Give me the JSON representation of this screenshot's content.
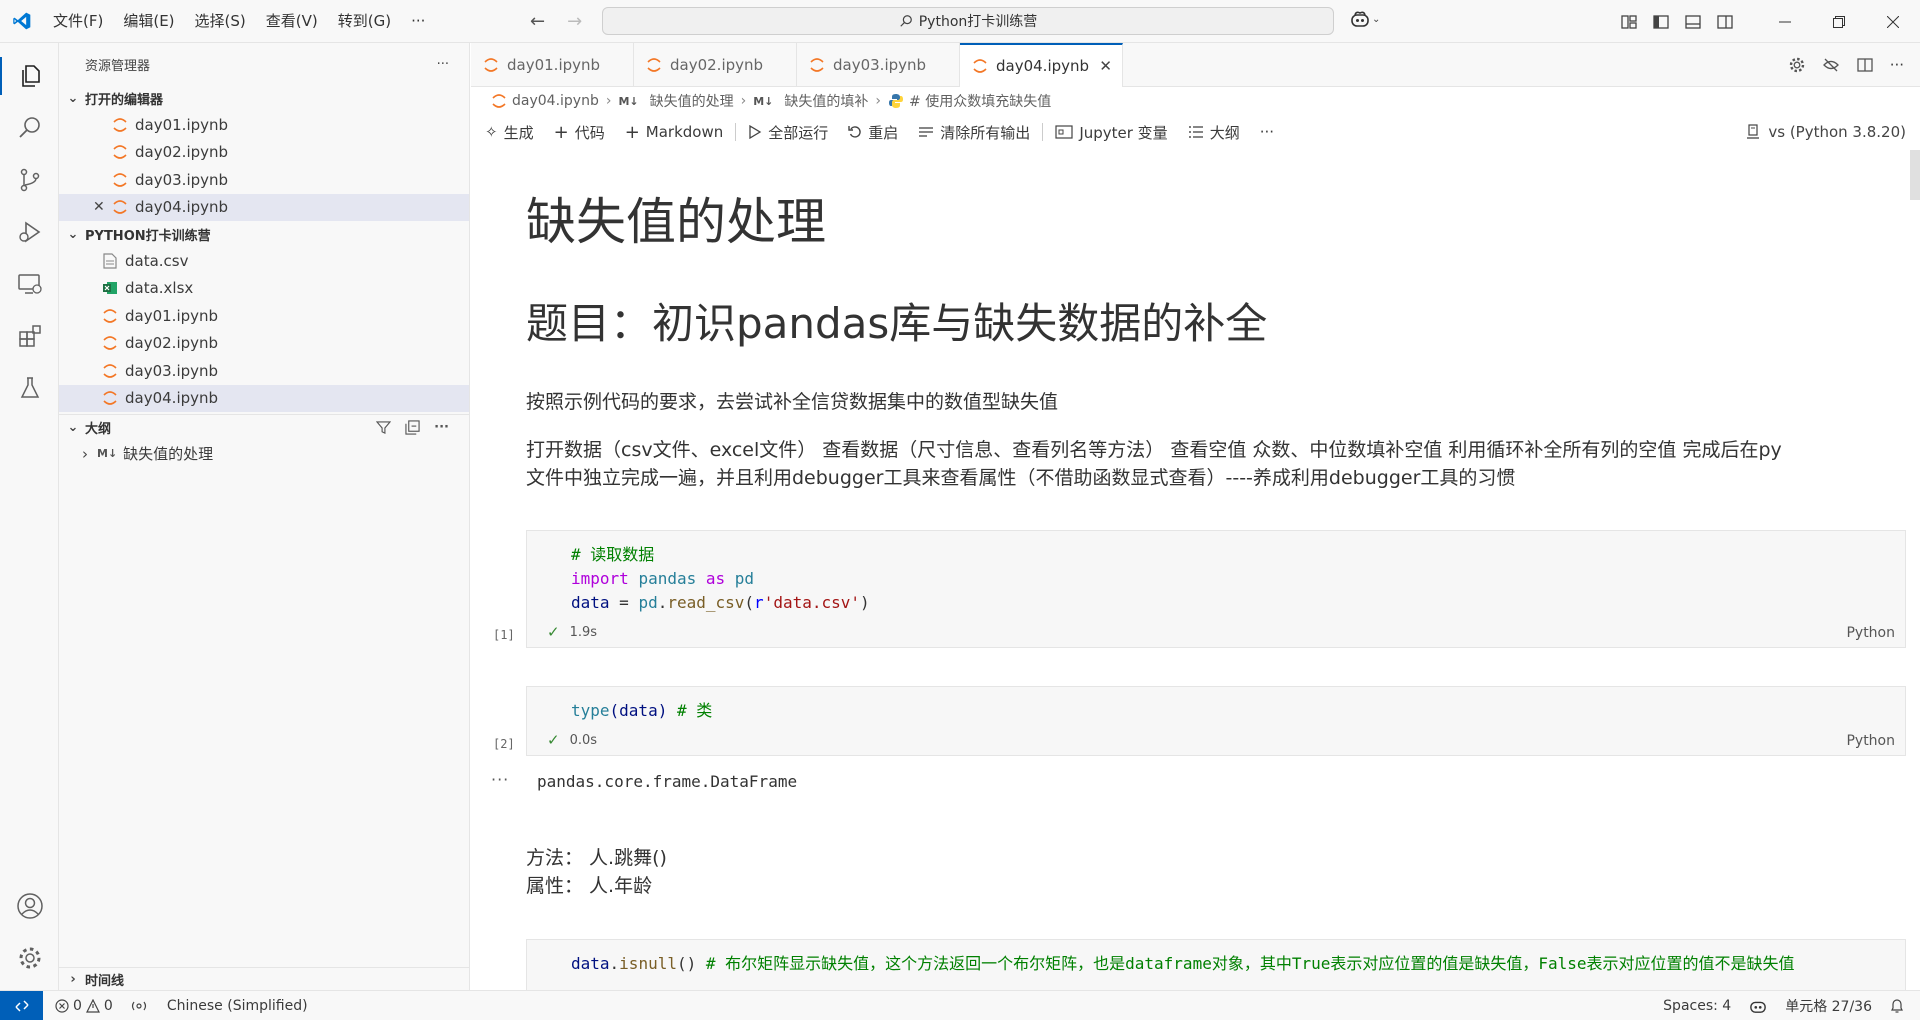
{
  "titlebar": {
    "menus": [
      "文件(F)",
      "编辑(E)",
      "选择(S)",
      "查看(V)",
      "转到(G)"
    ],
    "more": "···",
    "search_text": "Python打卡训练营"
  },
  "sidebar": {
    "title": "资源管理器",
    "more": "···",
    "open_editors_label": "打开的编辑器",
    "open_editors": [
      "day01.ipynb",
      "day02.ipynb",
      "day03.ipynb",
      "day04.ipynb"
    ],
    "folder_label": "PYTHON打卡训练营",
    "files": [
      {
        "name": "data.csv",
        "icon": "csv-file-icon"
      },
      {
        "name": "data.xlsx",
        "icon": "excel-file-icon"
      },
      {
        "name": "day01.ipynb",
        "icon": "jupyter-icon"
      },
      {
        "name": "day02.ipynb",
        "icon": "jupyter-icon"
      },
      {
        "name": "day03.ipynb",
        "icon": "jupyter-icon"
      },
      {
        "name": "day04.ipynb",
        "icon": "jupyter-icon"
      }
    ],
    "outline_label": "大纲",
    "outline_badge": "M↓",
    "outline_item": "缺失值的处理",
    "timeline_label": "时间线"
  },
  "tabs": [
    "day01.ipynb",
    "day02.ipynb",
    "day03.ipynb",
    "day04.ipynb"
  ],
  "breadcrumb": {
    "file": "day04.ipynb",
    "badge": "M↓",
    "part1": "缺失值的处理",
    "part2": "缺失值的填补",
    "part3": "# 使用众数填充缺失值"
  },
  "toolbar": {
    "generate": "生成",
    "code": "代码",
    "markdown": "Markdown",
    "run_all": "全部运行",
    "restart": "重启",
    "clear_outputs": "清除所有输出",
    "jupyter_vars": "Jupyter 变量",
    "outline": "大纲",
    "more": "···",
    "kernel": "vs (Python 3.8.20)"
  },
  "notebook": {
    "h1": "缺失值的处理",
    "h2": "题目：初识pandas库与缺失数据的补全",
    "p1": "按照示例代码的要求，去尝试补全信贷数据集中的数值型缺失值",
    "p2_line1": "打开数据（csv文件、excel文件） 查看数据（尺寸信息、查看列名等方法） 查看空值 众数、中位数填补空值 利用循环补全所有列的空值 完成后在py",
    "p2_line2": "文件中独立完成一遍，并且利用debugger工具来查看属性（不借助函数显式查看）----养成利用debugger工具的习惯",
    "cell1": {
      "line1": "# 读取数据",
      "kw_import": "import",
      "mod_pandas": "pandas",
      "kw_as": "as",
      "mod_pd": "pd",
      "var_data": "data",
      "eq": " = ",
      "pd2": "pd",
      "dot": ".",
      "fn": "read_csv",
      "paren_open": "(",
      "str_prefix": "r",
      "str": "'data.csv'",
      "paren_close": ")",
      "count": "[1]",
      "time": "1.9s",
      "lang": "Python"
    },
    "cell2": {
      "fn": "type",
      "arg": "(data)",
      "comment": " # 类",
      "count": "[2]",
      "time": "0.0s",
      "lang": "Python",
      "output_dots": "···",
      "output": "pandas.core.frame.DataFrame"
    },
    "note_line1": "方法： 人.跳舞()",
    "note_line2": "属性： 人.年龄",
    "cell3": {
      "var": "data",
      "dot": ".",
      "fn": "isnull",
      "parens": "()",
      "comment": " # 布尔矩阵显示缺失值，这个方法返回一个布尔矩阵，也是dataframe对象，其中True表示对应位置的值是缺失值，False表示对应位置的值不是缺失值"
    }
  },
  "statusbar": {
    "errors": "0",
    "warnings": "0",
    "language": "Chinese (Simplified)",
    "spaces": "Spaces: 4",
    "cell_pos": "单元格 27/36"
  },
  "colors": {
    "accent": "#005fb8",
    "jupyter": "#f37726",
    "excel": "#1d6f42"
  }
}
